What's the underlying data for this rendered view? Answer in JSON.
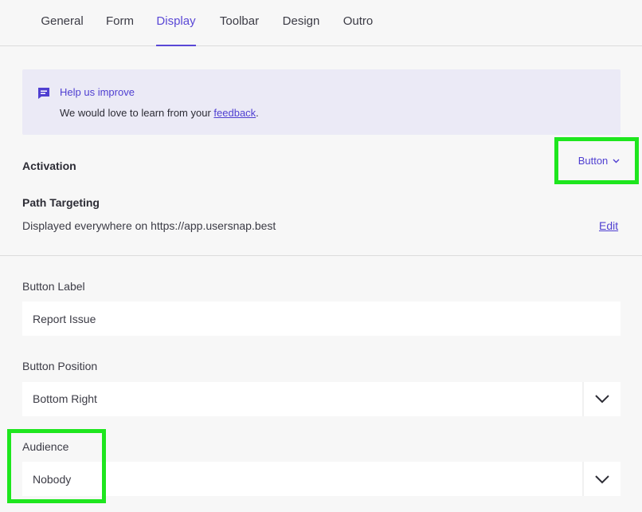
{
  "tabs": [
    {
      "label": "General",
      "active": false
    },
    {
      "label": "Form",
      "active": false
    },
    {
      "label": "Display",
      "active": true
    },
    {
      "label": "Toolbar",
      "active": false
    },
    {
      "label": "Design",
      "active": false
    },
    {
      "label": "Outro",
      "active": false
    }
  ],
  "help": {
    "icon": "comment-icon",
    "title": "Help us improve",
    "text_before": "We would love to learn from your ",
    "link": "feedback",
    "text_after": "."
  },
  "activation": {
    "label": "Activation",
    "value": "Button"
  },
  "path_targeting": {
    "label": "Path Targeting",
    "description": "Displayed everywhere on https://app.usersnap.best",
    "edit_label": "Edit"
  },
  "button_label": {
    "label": "Button Label",
    "value": "Report Issue"
  },
  "button_position": {
    "label": "Button Position",
    "value": "Bottom Right"
  },
  "audience": {
    "label": "Audience",
    "value": "Nobody"
  },
  "colors": {
    "accent": "#5a48d6",
    "highlight": "#1ee61e",
    "help_bg": "#ebeaf6",
    "page_bg": "#f7f7f7"
  }
}
